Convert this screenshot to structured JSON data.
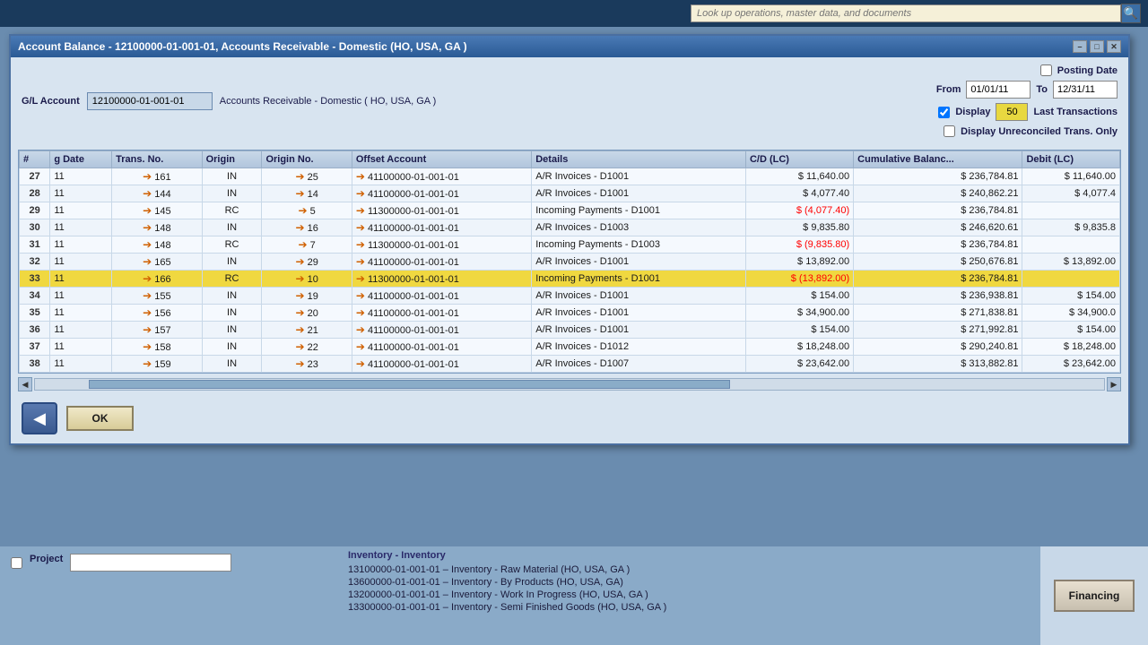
{
  "topbar": {
    "search_placeholder": "Look up operations, master data, and documents",
    "search_icon": "🔍"
  },
  "dialog": {
    "title": "Account Balance - 12100000-01-001-01, Accounts Receivable - Domestic (HO, USA, GA )",
    "min_label": "–",
    "restore_label": "□",
    "close_label": "✕"
  },
  "form": {
    "gl_account_label": "G/L Account",
    "gl_account_value": "12100000-01-001-01",
    "account_name": "Accounts Receivable - Domestic ( HO, USA, GA )",
    "posting_date_label": "Posting Date",
    "from_label": "From",
    "to_label": "To",
    "from_value": "01/01/11",
    "to_value": "12/31/11",
    "display_label": "Display",
    "last_trans_count": "50",
    "last_transactions_label": "Last Transactions",
    "display_unreconciled_label": "Display Unreconciled Trans. Only"
  },
  "table": {
    "columns": [
      "#",
      "g Date",
      "Trans. No.",
      "Origin",
      "Origin No.",
      "Offset Account",
      "Details",
      "C/D (LC)",
      "Cumulative Balanc...",
      "Debit (LC)"
    ],
    "rows": [
      {
        "num": "27",
        "date": "11",
        "trans": "161",
        "origin": "IN",
        "origin_no": "25",
        "offset": "41100000-01-001-01",
        "details": "A/R Invoices - D1001",
        "cd": "$ 11,640.00",
        "cum": "$ 236,784.81",
        "debit": "$ 11,640.00",
        "highlight": false
      },
      {
        "num": "28",
        "date": "11",
        "trans": "144",
        "origin": "IN",
        "origin_no": "14",
        "offset": "41100000-01-001-01",
        "details": "A/R Invoices - D1001",
        "cd": "$ 4,077.40",
        "cum": "$ 240,862.21",
        "debit": "$ 4,077.4",
        "highlight": false
      },
      {
        "num": "29",
        "date": "11",
        "trans": "145",
        "origin": "RC",
        "origin_no": "5",
        "offset": "11300000-01-001-01",
        "details": "Incoming Payments - D1001",
        "cd": "$ (4,077.40)",
        "cum": "$ 236,784.81",
        "debit": "",
        "highlight": false,
        "negative": true
      },
      {
        "num": "30",
        "date": "11",
        "trans": "148",
        "origin": "IN",
        "origin_no": "16",
        "offset": "41100000-01-001-01",
        "details": "A/R Invoices - D1003",
        "cd": "$ 9,835.80",
        "cum": "$ 246,620.61",
        "debit": "$ 9,835.8",
        "highlight": false
      },
      {
        "num": "31",
        "date": "11",
        "trans": "148",
        "origin": "RC",
        "origin_no": "7",
        "offset": "11300000-01-001-01",
        "details": "Incoming Payments - D1003",
        "cd": "$ (9,835.80)",
        "cum": "$ 236,784.81",
        "debit": "",
        "highlight": false,
        "negative": true
      },
      {
        "num": "32",
        "date": "11",
        "trans": "165",
        "origin": "IN",
        "origin_no": "29",
        "offset": "41100000-01-001-01",
        "details": "A/R Invoices - D1001",
        "cd": "$ 13,892.00",
        "cum": "$ 250,676.81",
        "debit": "$ 13,892.00",
        "highlight": false
      },
      {
        "num": "33",
        "date": "11",
        "trans": "166",
        "origin": "RC",
        "origin_no": "10",
        "offset": "11300000-01-001-01",
        "details": "Incoming Payments - D1001",
        "cd": "$ (13,892.00)",
        "cum": "$ 236,784.81",
        "debit": "",
        "highlight": true,
        "negative": true
      },
      {
        "num": "34",
        "date": "11",
        "trans": "155",
        "origin": "IN",
        "origin_no": "19",
        "offset": "41100000-01-001-01",
        "details": "A/R Invoices - D1001",
        "cd": "$ 154.00",
        "cum": "$ 236,938.81",
        "debit": "$ 154.00",
        "highlight": false
      },
      {
        "num": "35",
        "date": "11",
        "trans": "156",
        "origin": "IN",
        "origin_no": "20",
        "offset": "41100000-01-001-01",
        "details": "A/R Invoices - D1001",
        "cd": "$ 34,900.00",
        "cum": "$ 271,838.81",
        "debit": "$ 34,900.0",
        "highlight": false
      },
      {
        "num": "36",
        "date": "11",
        "trans": "157",
        "origin": "IN",
        "origin_no": "21",
        "offset": "41100000-01-001-01",
        "details": "A/R Invoices - D1001",
        "cd": "$ 154.00",
        "cum": "$ 271,992.81",
        "debit": "$ 154.00",
        "highlight": false
      },
      {
        "num": "37",
        "date": "11",
        "trans": "158",
        "origin": "IN",
        "origin_no": "22",
        "offset": "41100000-01-001-01",
        "details": "A/R Invoices - D1012",
        "cd": "$ 18,248.00",
        "cum": "$ 290,240.81",
        "debit": "$ 18,248.00",
        "highlight": false
      },
      {
        "num": "38",
        "date": "11",
        "trans": "159",
        "origin": "IN",
        "origin_no": "23",
        "offset": "41100000-01-001-01",
        "details": "A/R Invoices - D1007",
        "cd": "$ 23,642.00",
        "cum": "$ 313,882.81",
        "debit": "$ 23,642.00",
        "highlight": false
      }
    ]
  },
  "buttons": {
    "back_icon": "◀",
    "ok_label": "OK"
  },
  "lower": {
    "inventory_title": "Inventory - Inventory",
    "items": [
      "13100000-01-001-01 – Inventory - Raw Material (HO, USA, GA )",
      "13600000-01-001-01 – Inventory - By Products (HO, USA, GA)",
      "13200000-01-001-01 – Inventory - Work In Progress (HO, USA, GA )",
      "13300000-01-001-01 – Inventory - Semi Finished Goods (HO, USA, GA )"
    ],
    "project_label": "Project",
    "financing_label": "Financing"
  }
}
